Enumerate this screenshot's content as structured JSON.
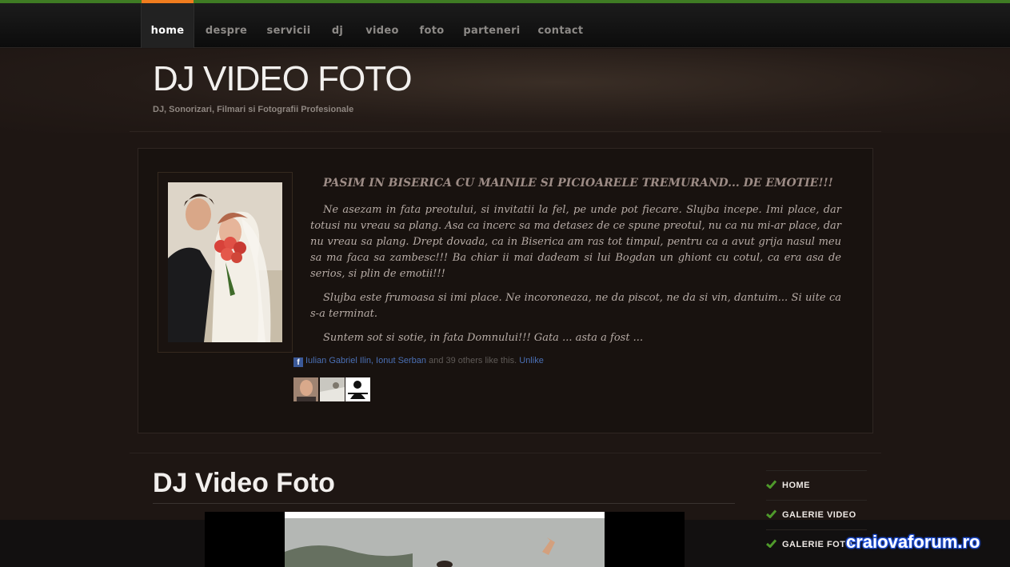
{
  "nav": {
    "items": [
      {
        "label": "home",
        "active": true
      },
      {
        "label": "despre",
        "active": false
      },
      {
        "label": "servicii",
        "active": false
      },
      {
        "label": "dj",
        "active": false
      },
      {
        "label": "video",
        "active": false
      },
      {
        "label": "foto",
        "active": false
      },
      {
        "label": "parteneri",
        "active": false
      },
      {
        "label": "contact",
        "active": false
      }
    ],
    "accent_color": "#f07c1e",
    "top_stripe_color": "#3f7c24"
  },
  "header": {
    "logo": "DJ VIDEO FOTO",
    "tagline": "DJ, Sonorizari, Filmari si Fotografii Profesionale"
  },
  "feature": {
    "title": "PASIM IN BISERICA CU MAINILE SI PICIOARELE TREMURAND... DE EMOTIE!!!",
    "paragraphs": [
      "Ne asezam in fata preotului, si invitatii la fel, pe unde pot fiecare. Slujba incepe. Imi place, dar totusi nu vreau sa plang. Asa ca incerc sa ma detasez de ce spune preotul, nu ca nu mi-ar place, dar nu vreau sa plang. Drept dovada, ca in Biserica am ras tot timpul, pentru ca a avut grija nasul meu sa ma faca sa zambesc!!! Ba chiar ii mai dadeam si lui Bogdan un ghiont cu cotul, ca era asa de serios, si plin de emotii!!!",
      "Slujba este frumoasa si imi place. Ne incoroneaza, ne da piscot, ne da si vin, dantuim... Si uite ca s-a terminat.",
      "Suntem sot si sotie, in fata Domnului!!! Gata ... asta a fost ..."
    ],
    "facebook": {
      "icon": "f",
      "people": "Iulian Gabriel Ilin, Ionut Serban",
      "rest": "and 39 others like this.",
      "unlike": "Unlike"
    }
  },
  "main": {
    "title": "DJ Video Foto"
  },
  "sidebar": {
    "items": [
      {
        "label": "HOME",
        "icon": "check-icon"
      },
      {
        "label": "GALERIE VIDEO",
        "icon": "check-icon"
      },
      {
        "label": "GALERIE FOTO",
        "icon": "check-icon"
      }
    ],
    "check_color": "#4f9a2b"
  },
  "watermark": "craiovaforum.ro"
}
